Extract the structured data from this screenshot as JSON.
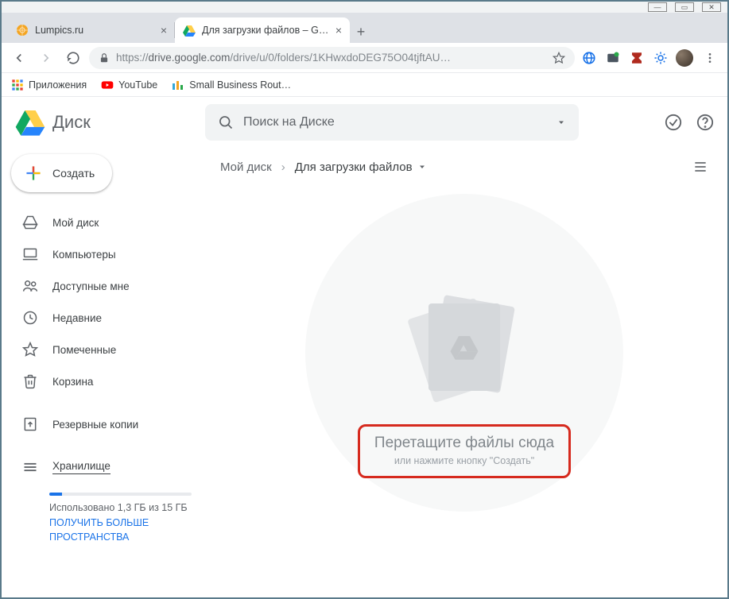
{
  "window": {
    "tabs": [
      {
        "label": "Lumpics.ru",
        "favicon": "orange-circle"
      },
      {
        "label": "Для загрузки файлов – Google ",
        "favicon": "drive"
      }
    ]
  },
  "address": {
    "scheme": "https://",
    "host": "drive.google.com",
    "path": "/drive/u/0/folders/1KHwxdoDEG75O04tjftAU…"
  },
  "bookmarks": [
    {
      "label": "Приложения",
      "icon": "apps"
    },
    {
      "label": "YouTube",
      "icon": "youtube"
    },
    {
      "label": "Small Business Rout…",
      "icon": "sbr"
    }
  ],
  "drive": {
    "product": "Диск",
    "search_placeholder": "Поиск на Диске",
    "create_label": "Создать",
    "nav": [
      {
        "label": "Мой диск",
        "icon": "mydrive"
      },
      {
        "label": "Компьютеры",
        "icon": "computers"
      },
      {
        "label": "Доступные мне",
        "icon": "shared"
      },
      {
        "label": "Недавние",
        "icon": "recent"
      },
      {
        "label": "Помеченные",
        "icon": "starred"
      },
      {
        "label": "Корзина",
        "icon": "trash"
      }
    ],
    "backup_label": "Резервные копии",
    "storage_label": "Хранилище",
    "storage_used": "Использовано 1,3 ГБ из 15 ГБ",
    "storage_link": "ПОЛУЧИТЬ БОЛЬШЕ ПРОСТРАНСТВА",
    "breadcrumb": {
      "root": "Мой диск",
      "current": "Для загрузки файлов"
    },
    "empty": {
      "title": "Перетащите файлы сюда",
      "sub": "или нажмите кнопку \"Создать\""
    }
  }
}
